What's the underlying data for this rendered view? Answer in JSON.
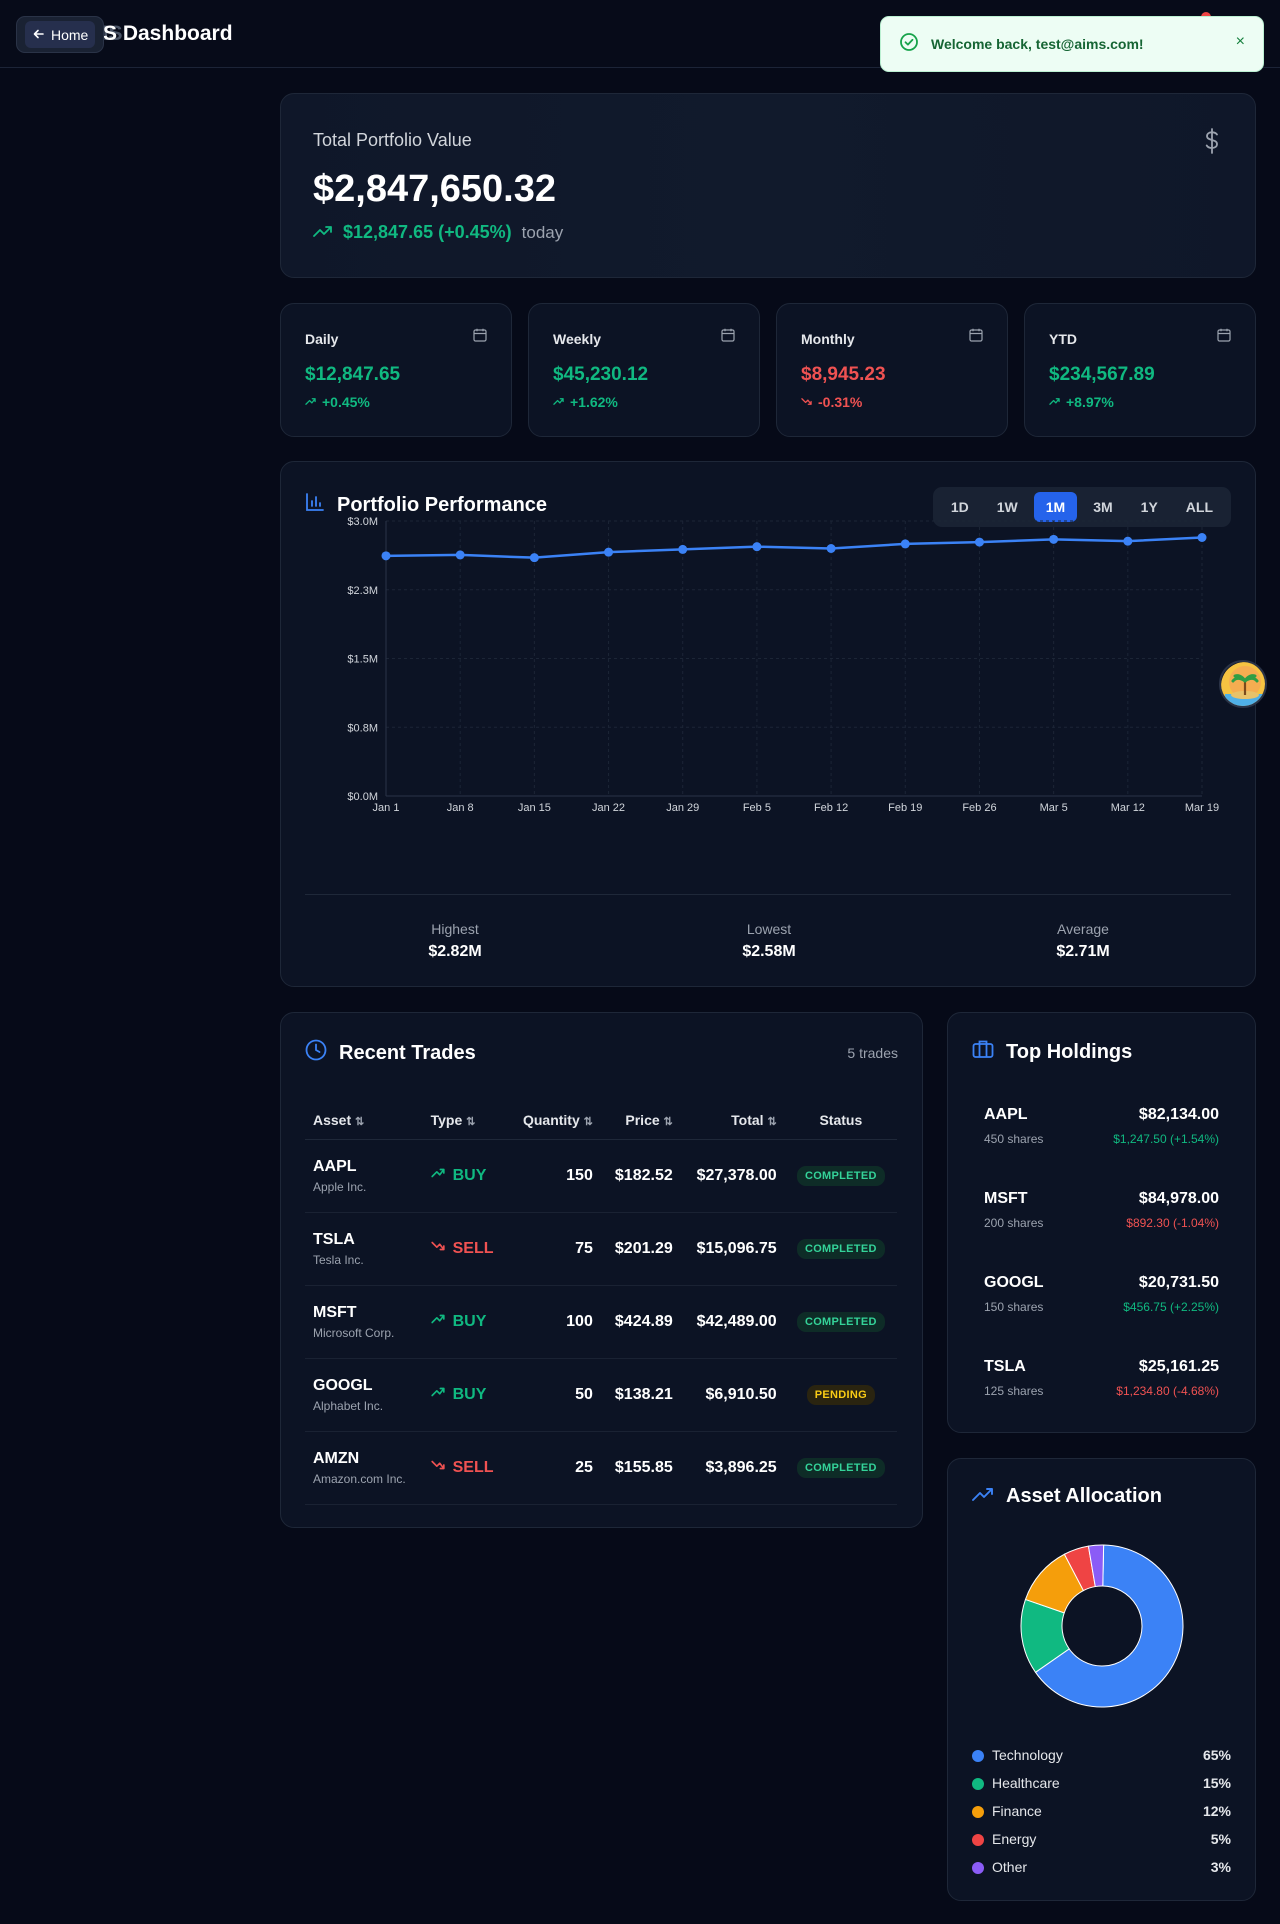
{
  "header": {
    "home_label": "Home",
    "brand_prefix": "AIMS",
    "brand_title": "S Dashboard"
  },
  "toast": {
    "message": "Welcome back, test@aims.com!",
    "close_icon": "×"
  },
  "portfolio": {
    "title": "Total Portfolio Value",
    "value": "$2,847,650.32",
    "change": "$12,847.65 (+0.45%)",
    "change_label": "today",
    "icon": "dollar-icon"
  },
  "stats": [
    {
      "label": "Daily",
      "value": "$12,847.65",
      "change": "+0.45%",
      "trend": "up"
    },
    {
      "label": "Weekly",
      "value": "$45,230.12",
      "change": "+1.62%",
      "trend": "up"
    },
    {
      "label": "Monthly",
      "value": "$8,945.23",
      "change": "-0.31%",
      "trend": "down"
    },
    {
      "label": "YTD",
      "value": "$234,567.89",
      "change": "+8.97%",
      "trend": "up"
    }
  ],
  "performance": {
    "title": "Portfolio Performance",
    "ranges": [
      "1D",
      "1W",
      "1M",
      "3M",
      "1Y",
      "ALL"
    ],
    "active_range": "1M",
    "summary": {
      "highest_label": "Highest",
      "highest": "$2.82M",
      "lowest_label": "Lowest",
      "lowest": "$2.58M",
      "average_label": "Average",
      "average": "$2.71M"
    }
  },
  "chart_data": {
    "type": "line",
    "x": [
      "Jan 1",
      "Jan 8",
      "Jan 15",
      "Jan 22",
      "Jan 29",
      "Feb 5",
      "Feb 12",
      "Feb 19",
      "Feb 26",
      "Mar 5",
      "Mar 12",
      "Mar 19"
    ],
    "series": [
      {
        "values": [
          2.62,
          2.63,
          2.6,
          2.66,
          2.69,
          2.72,
          2.7,
          2.75,
          2.77,
          2.8,
          2.78,
          2.82
        ]
      }
    ],
    "y_ticks": [
      "$0.0M",
      "$0.8M",
      "$1.5M",
      "$2.3M",
      "$3.0M"
    ],
    "ylim": [
      0,
      3.0
    ],
    "grid": true,
    "color": "#3b82f6"
  },
  "trades": {
    "title": "Recent Trades",
    "count": "5 trades",
    "columns": {
      "asset": "Asset",
      "type": "Type",
      "quantity": "Quantity",
      "price": "Price",
      "total": "Total",
      "status": "Status"
    },
    "rows": [
      {
        "symbol": "AAPL",
        "name": "Apple Inc.",
        "type": "BUY",
        "quantity": "150",
        "price": "$182.52",
        "total": "$27,378.00",
        "status": "COMPLETED"
      },
      {
        "symbol": "TSLA",
        "name": "Tesla Inc.",
        "type": "SELL",
        "quantity": "75",
        "price": "$201.29",
        "total": "$15,096.75",
        "status": "COMPLETED"
      },
      {
        "symbol": "MSFT",
        "name": "Microsoft Corp.",
        "type": "BUY",
        "quantity": "100",
        "price": "$424.89",
        "total": "$42,489.00",
        "status": "COMPLETED"
      },
      {
        "symbol": "GOOGL",
        "name": "Alphabet Inc.",
        "type": "BUY",
        "quantity": "50",
        "price": "$138.21",
        "total": "$6,910.50",
        "status": "PENDING"
      },
      {
        "symbol": "AMZN",
        "name": "Amazon.com Inc.",
        "type": "SELL",
        "quantity": "25",
        "price": "$155.85",
        "total": "$3,896.25",
        "status": "COMPLETED"
      }
    ]
  },
  "holdings": {
    "title": "Top Holdings",
    "items": [
      {
        "symbol": "AAPL",
        "shares": "450 shares",
        "value": "$82,134.00",
        "change": "$1,247.50 (+1.54%)",
        "trend": "up"
      },
      {
        "symbol": "MSFT",
        "shares": "200 shares",
        "value": "$84,978.00",
        "change": "$892.30 (-1.04%)",
        "trend": "down"
      },
      {
        "symbol": "GOOGL",
        "shares": "150 shares",
        "value": "$20,731.50",
        "change": "$456.75 (+2.25%)",
        "trend": "up"
      },
      {
        "symbol": "TSLA",
        "shares": "125 shares",
        "value": "$25,161.25",
        "change": "$1,234.80 (-4.68%)",
        "trend": "down"
      }
    ]
  },
  "allocation": {
    "title": "Asset Allocation",
    "items": [
      {
        "name": "Technology",
        "pct": "65%",
        "value": 65,
        "color": "#3b82f6"
      },
      {
        "name": "Healthcare",
        "pct": "15%",
        "value": 15,
        "color": "#10b981"
      },
      {
        "name": "Finance",
        "pct": "12%",
        "value": 12,
        "color": "#f59e0b"
      },
      {
        "name": "Energy",
        "pct": "5%",
        "value": 5,
        "color": "#ef4444"
      },
      {
        "name": "Other",
        "pct": "3%",
        "value": 3,
        "color": "#8b5cf6"
      }
    ]
  }
}
